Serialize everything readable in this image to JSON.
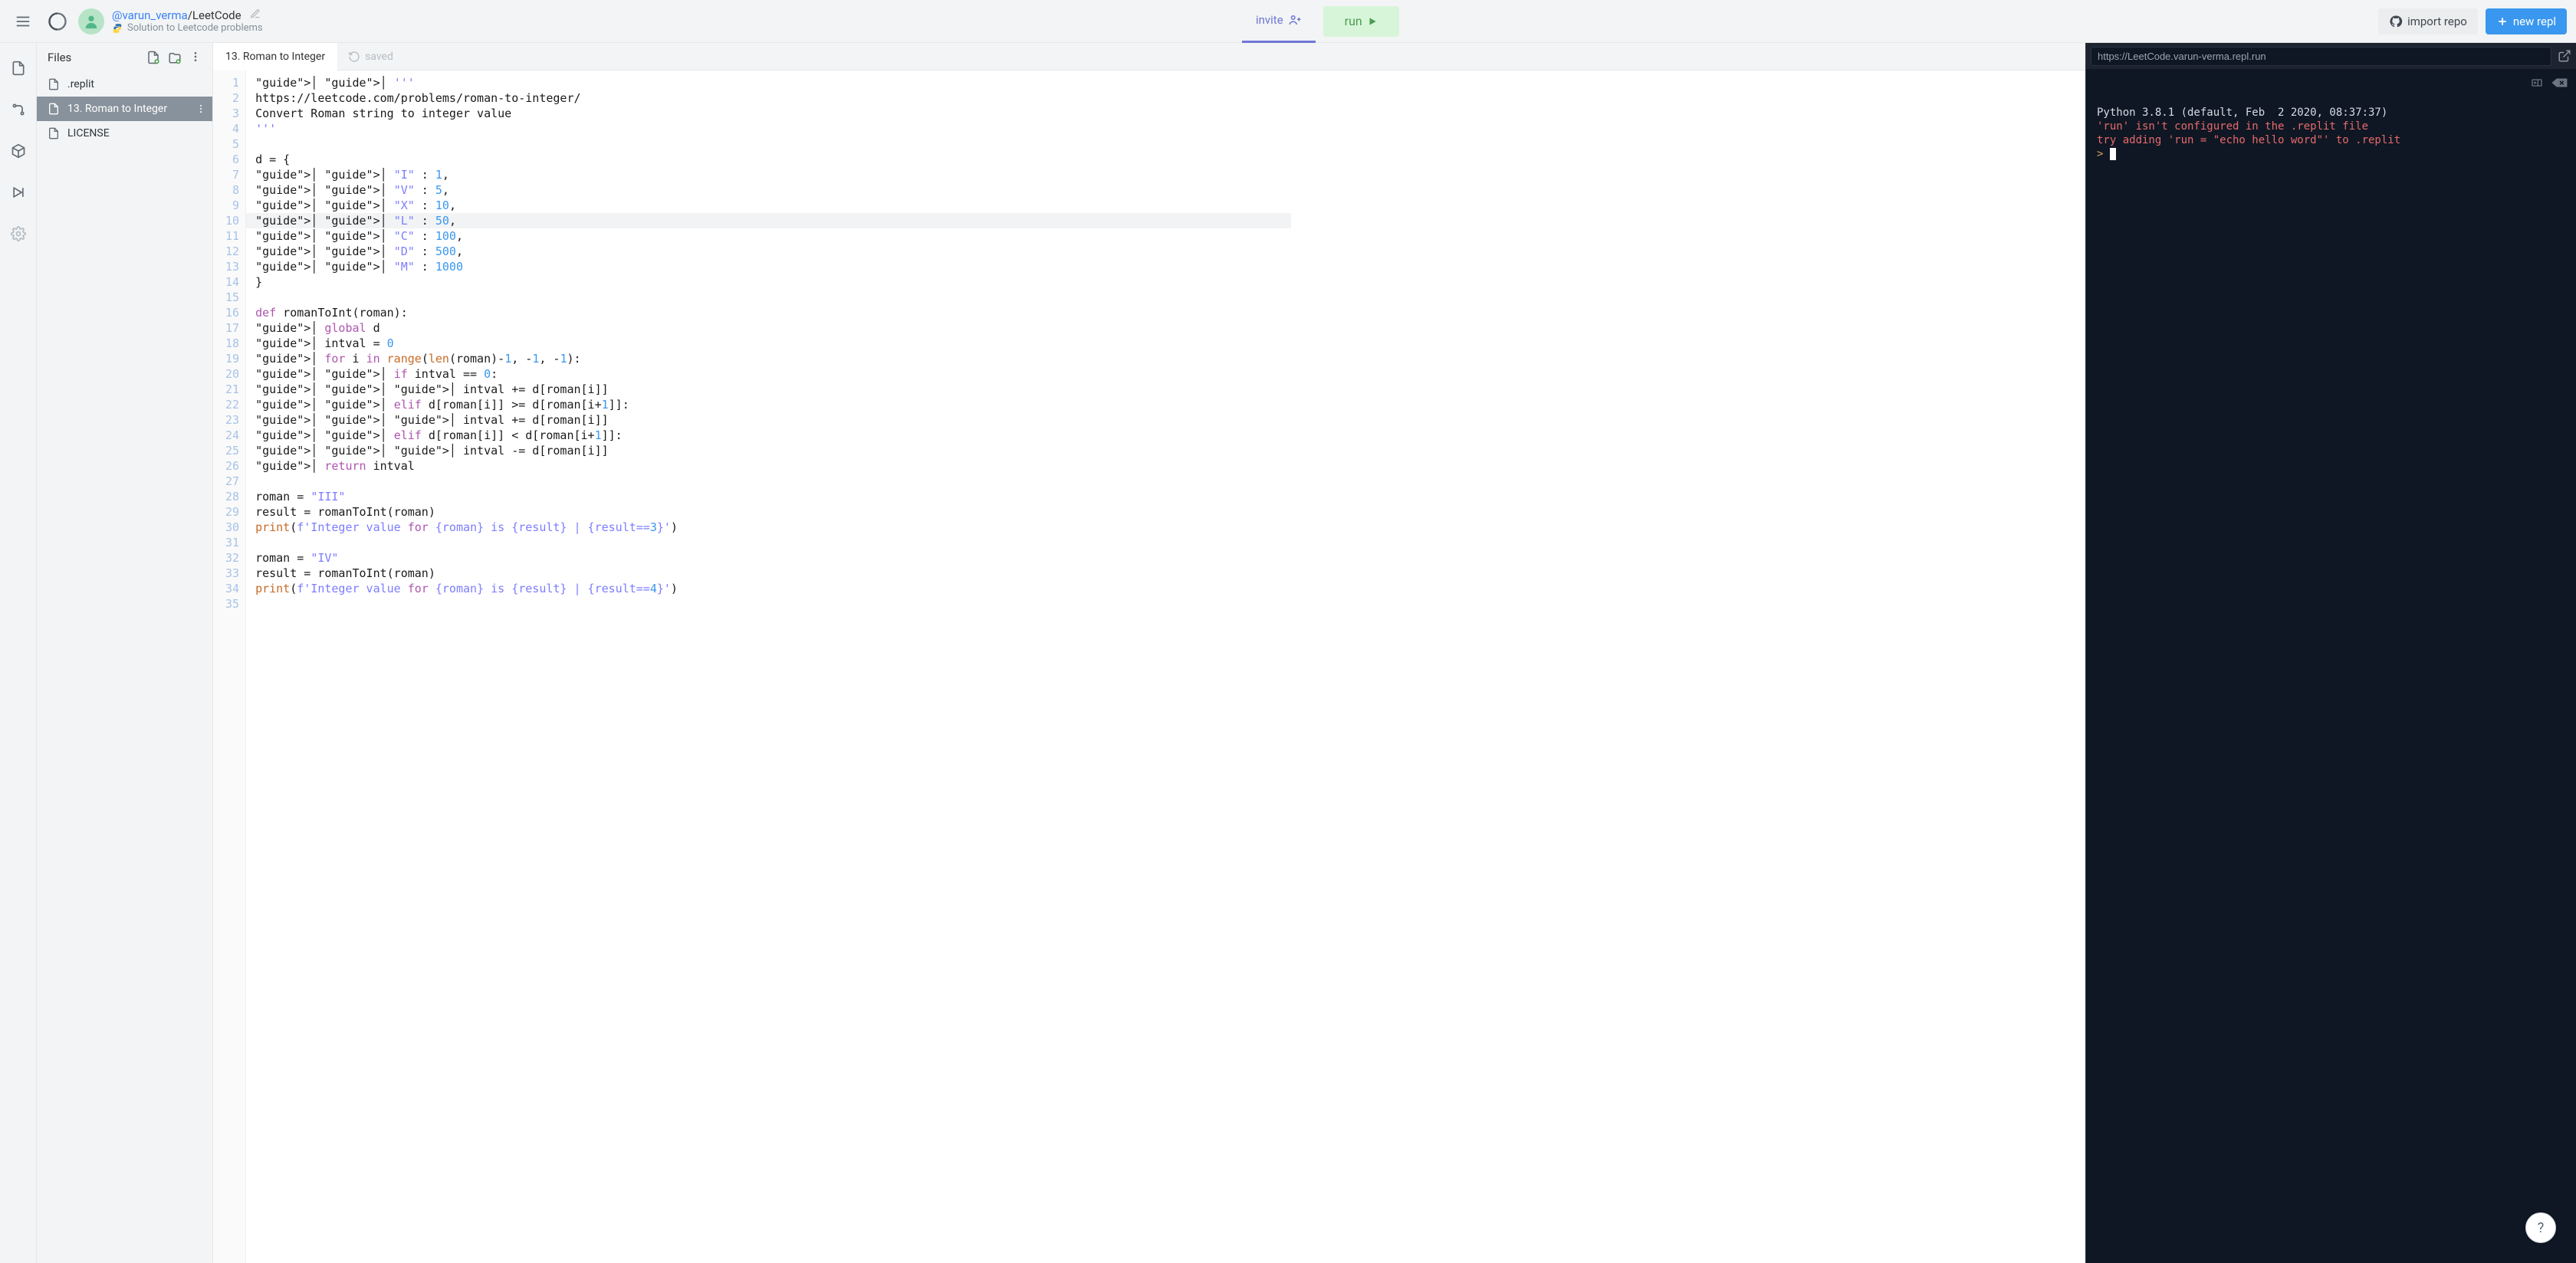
{
  "header": {
    "author": "@varun_verma",
    "separator": "/",
    "project": "LeetCode",
    "subtitle": "Solution to Leetcode problems",
    "invite_label": "invite",
    "run_label": "run",
    "import_label": "import repo",
    "newrepl_label": "new repl"
  },
  "sidebar": {
    "title": "Files",
    "items": [
      {
        "name": ".replit"
      },
      {
        "name": "13. Roman to Integer"
      },
      {
        "name": "LICENSE"
      }
    ],
    "active_index": 1
  },
  "tabs": {
    "open": "13. Roman to Integer",
    "status": "saved"
  },
  "code_lines": [
    "    '''",
    "https://leetcode.com/problems/roman-to-integer/",
    "Convert Roman string to integer value",
    "'''",
    "",
    "d = {",
    "    \"I\" : 1,",
    "    \"V\" : 5,",
    "    \"X\" : 10,",
    "    \"L\" : 50,",
    "    \"C\" : 100,",
    "    \"D\" : 500,",
    "    \"M\" : 1000",
    "}",
    "",
    "def romanToInt(roman):",
    "  global d",
    "  intval = 0",
    "  for i in range(len(roman)-1, -1, -1):",
    "    if intval == 0:",
    "      intval += d[roman[i]]",
    "    elif d[roman[i]] >= d[roman[i+1]]:",
    "      intval += d[roman[i]]",
    "    elif d[roman[i]] < d[roman[i+1]]:",
    "      intval -= d[roman[i]]",
    "  return intval",
    "",
    "roman = \"III\"",
    "result = romanToInt(roman)",
    "print(f'Integer value for {roman} is {result} | {result==3}')",
    "",
    "roman = \"IV\"",
    "result = romanToInt(roman)",
    "print(f'Integer value for {roman} is {result} | {result==4}')",
    ""
  ],
  "highlight_line": 10,
  "console": {
    "url": "https://LeetCode.varun-verma.repl.run",
    "line1": "Python 3.8.1 (default, Feb  2 2020, 08:37:37)",
    "line2": "'run' isn't configured in the .replit file",
    "line3": "try adding 'run = \"echo hello word\"' to .replit",
    "prompt": ">"
  },
  "help_label": "?"
}
